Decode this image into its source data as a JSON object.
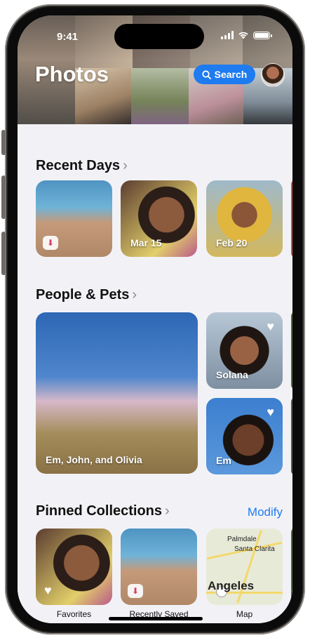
{
  "status_bar": {
    "time": "9:41"
  },
  "header": {
    "title": "Photos",
    "search_label": "Search"
  },
  "sections": {
    "recent_days": {
      "title": "Recent Days",
      "cards": [
        {
          "label": ""
        },
        {
          "label": "Mar 15"
        },
        {
          "label": "Feb 20"
        }
      ]
    },
    "people_pets": {
      "title": "People & Pets",
      "cards": [
        {
          "label": "Em, John, and Olivia"
        },
        {
          "label": "Solana"
        },
        {
          "label": "Em"
        }
      ]
    },
    "pinned_collections": {
      "title": "Pinned Collections",
      "modify_label": "Modify",
      "items": [
        {
          "caption": "Favorites"
        },
        {
          "caption": "Recently Saved"
        },
        {
          "caption": "Map"
        }
      ],
      "map_labels": {
        "palmdale": "Palmdale",
        "santa_clarita": "Santa Clarita",
        "city": "Angeles"
      }
    }
  },
  "icons": {
    "search": "magnifier-icon",
    "chevron": "chevron-right-icon",
    "heart": "heart-icon",
    "saved": "tray-arrow-icon"
  },
  "colors": {
    "accent": "#1e7bf0",
    "background": "#f2f2f6"
  }
}
